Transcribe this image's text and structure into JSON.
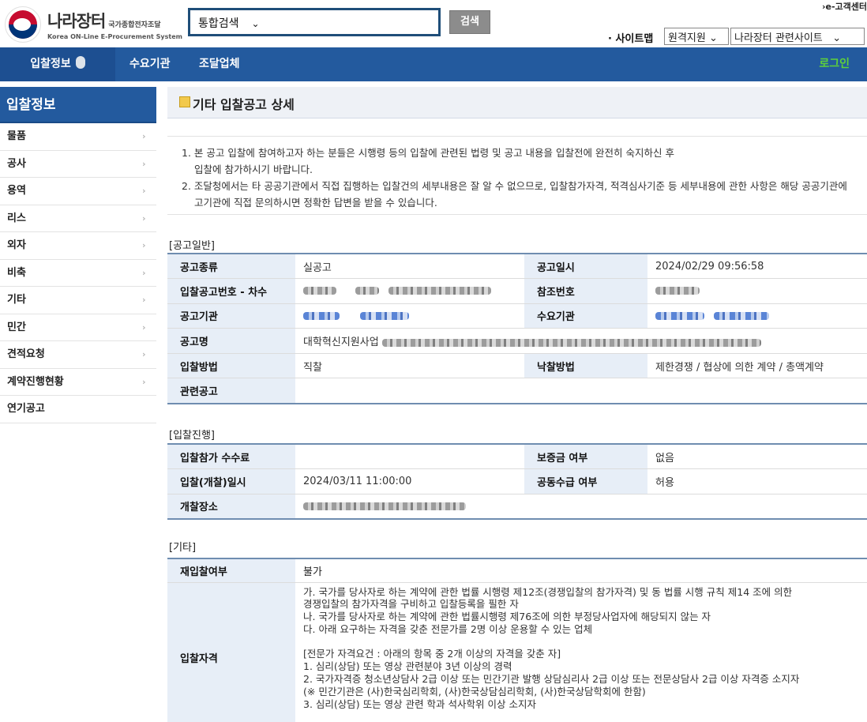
{
  "header": {
    "logo_ko": "나라장터",
    "logo_sub": "국가종합전자조달",
    "logo_en": "Korea ON-Line E-Procurement System",
    "search_select": "통합검색",
    "search_button": "검색",
    "ecustomer": "e-고객센터",
    "sitemap": "· 사이트맵",
    "select1": "원격지원",
    "select2": "나라장터 관련사이트"
  },
  "nav": {
    "items": [
      "입찰정보",
      "수요기관",
      "조달업체"
    ],
    "login": "로그인"
  },
  "sidebar": {
    "title": "입찰정보",
    "items": [
      {
        "label": "물품",
        "arrow": true
      },
      {
        "label": "공사",
        "arrow": true
      },
      {
        "label": "용역",
        "arrow": true
      },
      {
        "label": "리스",
        "arrow": true
      },
      {
        "label": "외자",
        "arrow": true
      },
      {
        "label": "비축",
        "arrow": true
      },
      {
        "label": "기타",
        "arrow": true
      },
      {
        "label": "민간",
        "arrow": true
      },
      {
        "label": "견적요청",
        "arrow": true
      },
      {
        "label": "계약진행현황",
        "arrow": true
      },
      {
        "label": "연기공고",
        "arrow": false
      }
    ]
  },
  "page": {
    "title": "기타 입찰공고 상세",
    "notice": [
      "1. 본 공고 입찰에 참여하고자 하는 분들은 시행령 등의 입찰에 관련된 법령 및 공고 내용을 입찰전에 완전히 숙지하신 후",
      "입찰에 참가하시기 바랍니다.",
      "2. 조달청에서는 타 공공기관에서 직접 집행하는 입찰건의 세부내용은 잘 알 수 없으므로, 입찰참가자격, 적격심사기준 등 세부내용에 관한 사항은 해당 공공기관에",
      "고기관에 직접 문의하시면 정확한 답변을 받을 수 있습니다."
    ]
  },
  "general": {
    "section": "[공고일반]",
    "labels": {
      "type": "공고종류",
      "date": "공고일시",
      "number": "입찰공고번호 - 차수",
      "ref": "참조번호",
      "org": "공고기관",
      "demand": "수요기관",
      "name": "공고명",
      "method": "입찰방법",
      "award": "낙찰방법",
      "related": "관련공고"
    },
    "values": {
      "type": "실공고",
      "date": "2024/02/29 09:56:58",
      "name_prefix": "대학혁신지원사업",
      "method": "직찰",
      "award": "제한경쟁 / 협상에 의한 계약 / 총액계약",
      "related": ""
    }
  },
  "progress": {
    "section": "[입찰진행]",
    "labels": {
      "fee": "입찰참가 수수료",
      "deposit": "보증금 여부",
      "open_date": "입찰(개찰)일시",
      "joint": "공동수급 여부",
      "place": "개찰장소"
    },
    "values": {
      "fee": "",
      "deposit": "없음",
      "open_date": "2024/03/11 11:00:00",
      "joint": "허용"
    }
  },
  "etc": {
    "section": "[기타]",
    "labels": {
      "rebid": "재입찰여부",
      "qualification": "입찰자격"
    },
    "values": {
      "rebid": "불가",
      "qualification_lines": [
        "가. 국가를 당사자로 하는 계약에 관한 법률 시행령 제12조(경쟁입찰의 참가자격) 및 동 법률 시행 규칙 제14 조에 의한",
        "경쟁입찰의 참가자격을 구비하고 입찰등록을 필한 자",
        "나. 국가를 당사자로 하는 계약에 관한 법률시행령 제76조에 의한 부정당사업자에 해당되지 않는 자",
        "다. 아래 요구하는 자격을 갖춘 전문가를 2명 이상 운용할 수 있는 업체",
        "",
        "[전문가 자격요건 : 아래의 항목 중 2개 이상의 자격을 갖춘 자]",
        "1. 심리(상담) 또는 영상 관련분야 3년 이상의 경력",
        "2. 국가자격증 청소년상담사 2급 이상 또는 민간기관 발행 상담심리사 2급 이상 또는 전문상담사 2급 이상 자격증 소지자",
        "(※ 민간기관은 (사)한국심리학회, (사)한국상담심리학회, (사)한국상담학회에 한함)",
        "3. 심리(상담) 또는 영상 관련 학과 석사학위 이상 소지자"
      ]
    }
  }
}
